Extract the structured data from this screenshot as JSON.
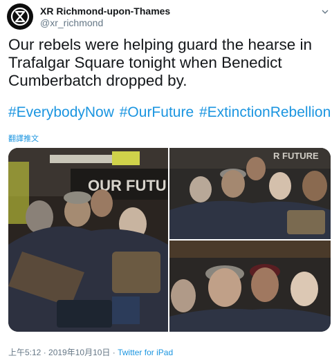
{
  "author": {
    "display_name": "XR Richmond-upon-Thames",
    "handle": "@xr_richmond",
    "avatar_icon": "extinction-symbol-icon"
  },
  "tweet": {
    "text": "Our rebels were helping guard the hearse in\nTrafalgar Square tonight when Benedict\nCumberbatch dropped by.",
    "hashtags": [
      "#EverybodyNow",
      "#OurFuture",
      "#ExtinctionRebellion"
    ],
    "translate_label": "翻譯推文"
  },
  "media": {
    "photo_count": 3,
    "banner_text_1": "OUR FUTU",
    "banner_text_2": "R FUTURE"
  },
  "footer": {
    "timestamp": "上午5:12 · 2019年10月10日",
    "separator": " · ",
    "source": "Twitter for iPad"
  },
  "colors": {
    "link": "#1b95e0",
    "secondary_text": "#657786",
    "primary_text": "#14171a"
  }
}
